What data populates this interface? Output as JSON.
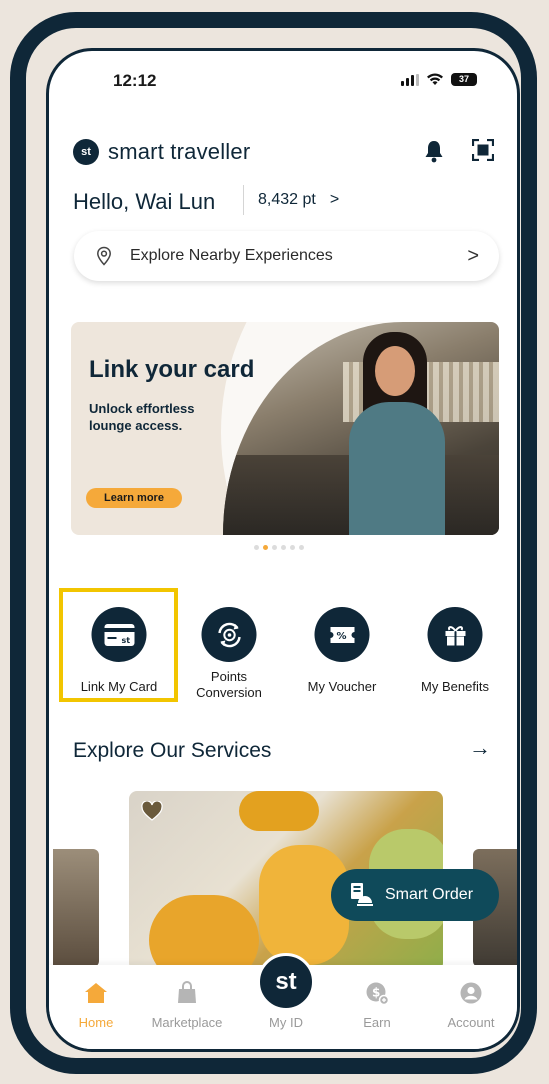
{
  "status_bar": {
    "time": "12:12",
    "battery": "37"
  },
  "header": {
    "brand_logo": "st",
    "brand_name": "smart traveller",
    "icons": [
      "bell-icon",
      "scan-icon"
    ]
  },
  "greeting": {
    "text": "Hello, Wai Lun",
    "points": "8,432 pt",
    "points_chevron": ">"
  },
  "explore_bar": {
    "label": "Explore Nearby Experiences",
    "chevron": ">"
  },
  "banner": {
    "title": "Link your card",
    "subtitle": "Unlock effortless lounge access.",
    "cta": "Learn more"
  },
  "carousel": {
    "total": 6,
    "active": 1
  },
  "quick_actions": [
    {
      "label": "Link My Card",
      "icon": "card-icon"
    },
    {
      "label": "Points\nConversion",
      "icon": "points-conversion-icon"
    },
    {
      "label": "My Voucher",
      "icon": "voucher-icon"
    },
    {
      "label": "My Benefits",
      "icon": "gift-icon"
    }
  ],
  "services": {
    "title": "Explore Our Services",
    "arrow": "→",
    "smart_order": "Smart Order"
  },
  "tabbar": {
    "items": [
      {
        "label": "Home",
        "icon": "home-icon"
      },
      {
        "label": "Marketplace",
        "icon": "bag-icon"
      },
      {
        "label": "My ID",
        "icon": "st-logo"
      },
      {
        "label": "Earn",
        "icon": "coin-icon"
      },
      {
        "label": "Account",
        "icon": "account-icon"
      }
    ],
    "active": "Home",
    "myid_logo": "st"
  },
  "colors": {
    "navy": "#0f2738",
    "accent": "#f5a93a",
    "highlight": "#f2c500",
    "teal": "#0f4a5a"
  }
}
